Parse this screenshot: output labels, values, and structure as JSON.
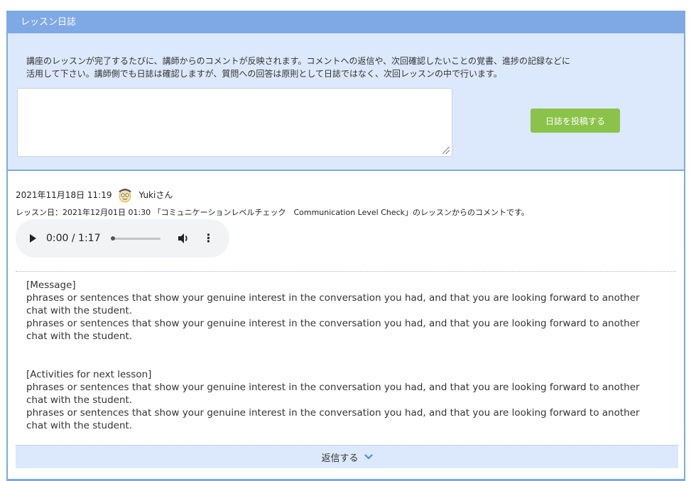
{
  "header": {
    "title": "レッスン日誌"
  },
  "compose": {
    "description_line1": "講座のレッスンが完了するたびに、講師からのコメントが反映されます。コメントへの返信や、次回確認したいことの覚書、進捗の記録などに",
    "description_line2": "活用して下さい。講師側でも日誌は確認しますが、質問への回答は原則として日誌ではなく、次回レッスンの中で行います。",
    "textarea_value": "",
    "post_button_label": "日誌を投稿する"
  },
  "entry": {
    "timestamp": "2021年11月18日 11:19",
    "author": "Yukiさん",
    "lesson_info": "レッスン日：2021年12月01日 01:30 「コミュニケーションレベルチェック　Communication Level Check」のレッスンからのコメントです。",
    "audio": {
      "time": "0:00 / 1:17"
    },
    "message_heading": "[Message]",
    "message_lines": [
      "phrases or sentences that show your genuine interest in the conversation you had, and that you are looking forward to another",
      "chat with the student.",
      "phrases or sentences that show your genuine interest in the conversation you had, and that you are looking forward to another",
      "chat with the student."
    ],
    "activities_heading": "[Activities for next lesson]",
    "activities_lines": [
      "phrases or sentences that show your genuine interest in the conversation you had, and that you are looking forward to another",
      "chat with the student.",
      "phrases or sentences that show your genuine interest in the conversation you had, and that you are looking forward to another",
      "chat with the student."
    ],
    "reply_label": "返信する"
  },
  "colors": {
    "accent": "#7fa9e4",
    "panel_bg": "#dce8fb",
    "button_green": "#8bc34a"
  }
}
